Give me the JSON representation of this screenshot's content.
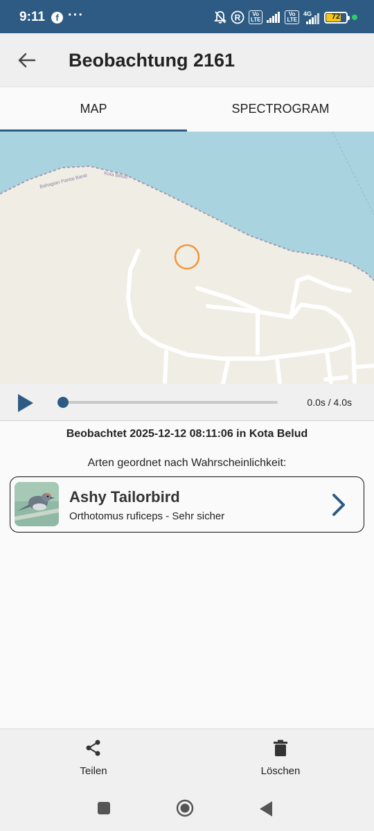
{
  "status_bar": {
    "time": "9:11",
    "battery_level": "72",
    "icons": [
      "facebook-icon",
      "more-dots-icon",
      "mute-bell-icon",
      "registered-icon",
      "volte-icon",
      "signal-icon",
      "4g-signal-icon",
      "battery-icon",
      "active-dot-icon"
    ],
    "volte_label": "Vo\nLTE",
    "network_label": "4G"
  },
  "app_bar": {
    "title": "Beobachtung 2161"
  },
  "tabs": [
    {
      "label": "MAP",
      "active": true
    },
    {
      "label": "SPECTROGRAM",
      "active": false
    }
  ],
  "map": {
    "labels": [
      "Bahagian Pantai Barat",
      "Kota Belud"
    ]
  },
  "player": {
    "time_label": "0.0s / 4.0s",
    "progress": 0
  },
  "observation": {
    "observed_text": "Beobachtet 2025-12-12 08:11:06 in Kota Belud",
    "sorted_heading": "Arten geordnet nach Wahrscheinlichkeit:"
  },
  "species": [
    {
      "common_name": "Ashy Tailorbird",
      "detail": "Orthotomus ruficeps - Sehr sicher"
    }
  ],
  "bottom_actions": {
    "share_label": "Teilen",
    "delete_label": "Löschen"
  },
  "colors": {
    "primary": "#2d5b83",
    "water": "#a9d3df",
    "land": "#f0ede5",
    "marker": "#f0963a"
  }
}
